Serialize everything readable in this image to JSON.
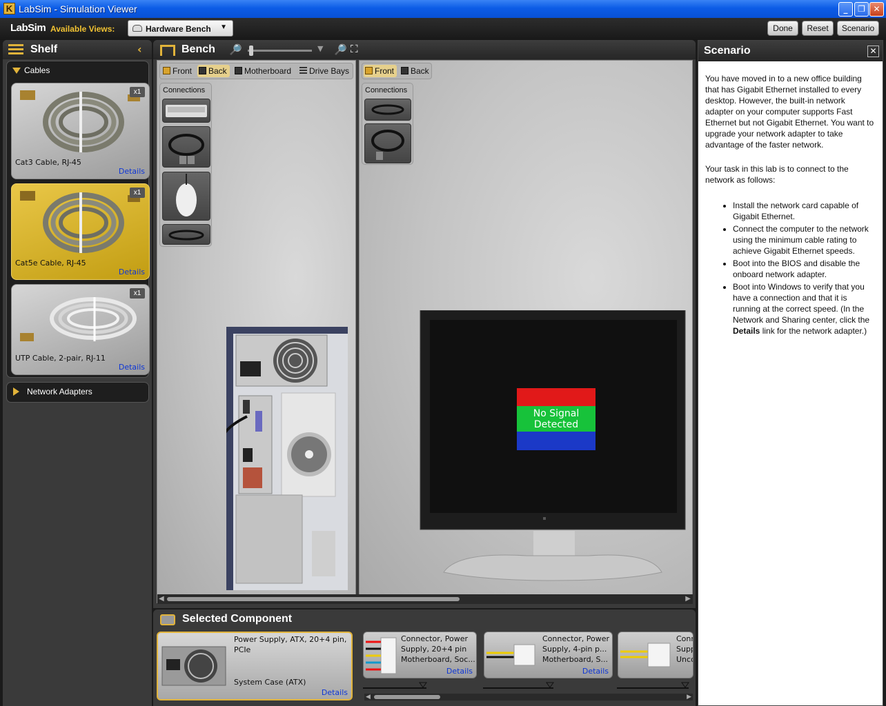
{
  "window": {
    "title": "LabSim - Simulation Viewer"
  },
  "toolbar": {
    "brand": "LabSim",
    "available_views_label": "Available Views:",
    "view_selected": "Hardware Bench",
    "done_label": "Done",
    "reset_label": "Reset",
    "scenario_label": "Scenario"
  },
  "shelf": {
    "title": "Shelf",
    "cables_label": "Cables",
    "network_adapters_label": "Network Adapters",
    "items": [
      {
        "name": "Cat3 Cable, RJ-45",
        "qty": "x1",
        "details": "Details"
      },
      {
        "name": "Cat5e Cable, RJ-45",
        "qty": "x1",
        "details": "Details"
      },
      {
        "name": "UTP Cable, 2-pair, RJ-11",
        "qty": "x1",
        "details": "Details"
      }
    ]
  },
  "bench": {
    "title": "Bench",
    "left_tabs": [
      "Front",
      "Back",
      "Motherboard",
      "Drive Bays"
    ],
    "right_tabs": [
      "Front",
      "Back"
    ],
    "connections_label": "Connections",
    "monitor_message_line1": "No Signal",
    "monitor_message_line2": "Detected"
  },
  "selected_component": {
    "title": "Selected Component",
    "main": {
      "name": "Power Supply, ATX, 20+4 pin, PCIe",
      "location": "System Case (ATX)",
      "details": "Details"
    },
    "connectors": [
      {
        "line1": "Connector, Power",
        "line2": "Supply, 20+4 pin",
        "line3": "Motherboard, Soc...",
        "details": "Details"
      },
      {
        "line1": "Connector, Power",
        "line2": "Supply, 4-pin p...",
        "line3": "Motherboard, S...",
        "details": "Details"
      },
      {
        "line1": "Conn",
        "line2": "Supp",
        "line3": "Unco"
      }
    ]
  },
  "scenario": {
    "title": "Scenario",
    "para1": "You have moved in to a new office building that has Gigabit Ethernet installed to every desktop. However, the built-in network adapter on your computer supports Fast Ethernet but not Gigabit Ethernet. You want to upgrade your network adapter to take advantage of the faster network.",
    "para2": "Your task in this lab is to connect to the network as follows:",
    "bullets": [
      "Install the network card capable of Gigabit Ethernet.",
      "Connect the computer to the network using the minimum cable rating to achieve Gigabit Ethernet speeds.",
      "Boot into the BIOS and disable the onboard network adapter."
    ],
    "bullet4_pre": "Boot into Windows to verify that you have a connection and that it is running at the correct speed. (In the Network and Sharing center, click the",
    "bullet4_bold": "Details",
    "bullet4_post": "link for the network adapter.)"
  },
  "colors": {
    "accent": "#e1b33a",
    "link": "#0e36d6",
    "title_bar": "#0c5ce6"
  }
}
